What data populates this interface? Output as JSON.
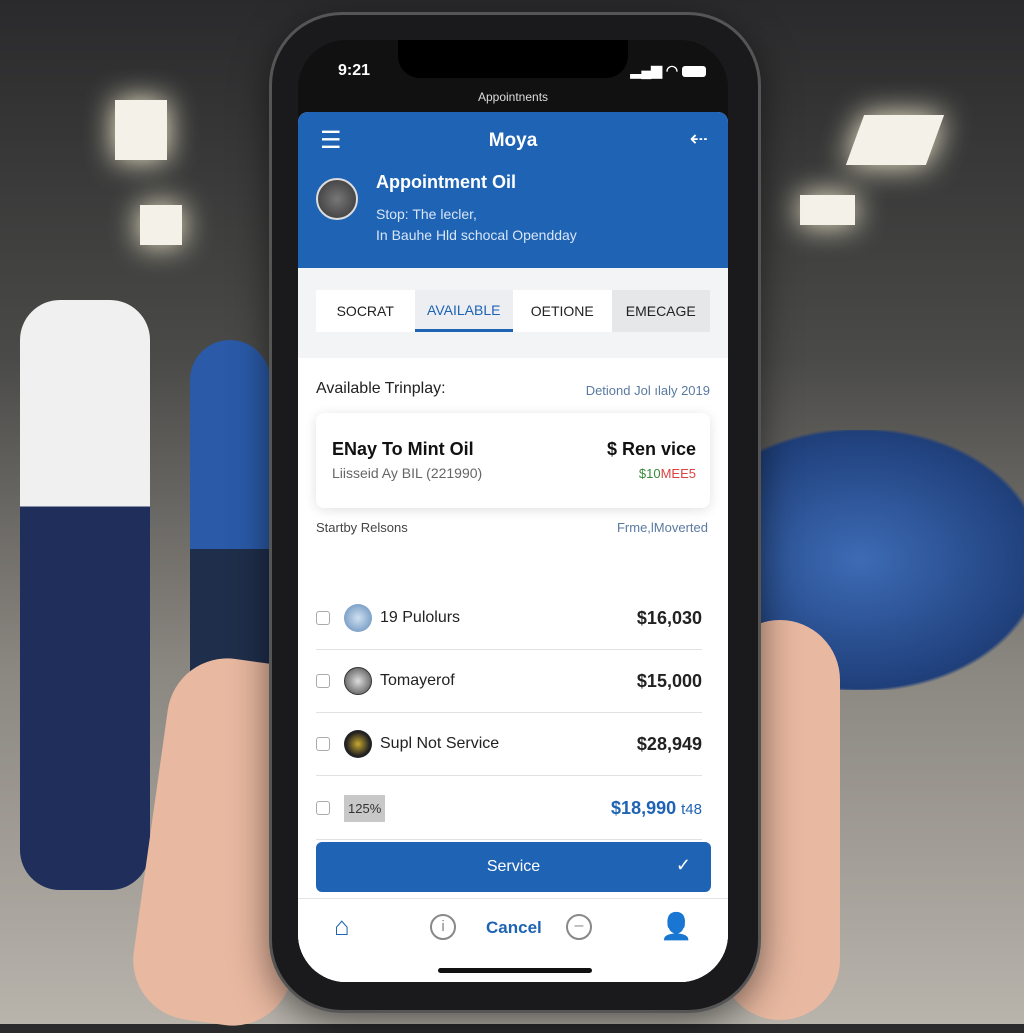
{
  "status": {
    "time": "9:21",
    "icons": [
      "signal-icon",
      "wifi-icon",
      "battery-icon"
    ]
  },
  "screen_title": "Appointnents",
  "header": {
    "title": "Moya",
    "heading": "Appointment Oil",
    "line1": "Stop: The lecler,",
    "line2": "In Bauhe Hld schocal Opendday"
  },
  "tabs": [
    {
      "label": "SOCRAT"
    },
    {
      "label": "AVAILABLE",
      "active": true
    },
    {
      "label": "OETIONE"
    },
    {
      "label": "EMECAGE"
    }
  ],
  "section": {
    "label": "Available Trinplay:",
    "date": "Detiond Jol ılaly 2019"
  },
  "card": {
    "title": "ENay To Mint Oil",
    "subtitle": "Liisseid Ay BIL (221990)",
    "price_label": "$ Ren vice",
    "amount_green": "$10",
    "amount_red": "MEE5"
  },
  "list_header": {
    "left": "Startby Relsons",
    "right": "Frme,lMoverted"
  },
  "rows": [
    {
      "name": "19 Pulolurs",
      "price": "$16,030"
    },
    {
      "name": "Tomayerof",
      "price": "$15,000"
    },
    {
      "name": "Supl Not Service",
      "price": "$28,949"
    },
    {
      "badge": "125%",
      "price": "$18,990",
      "suffix": "t48"
    }
  ],
  "service_button": "Service",
  "nav": {
    "cancel": "Cancel"
  },
  "colors": {
    "primary": "#1e63b4",
    "green": "#3a8a3a",
    "red": "#e04040"
  }
}
